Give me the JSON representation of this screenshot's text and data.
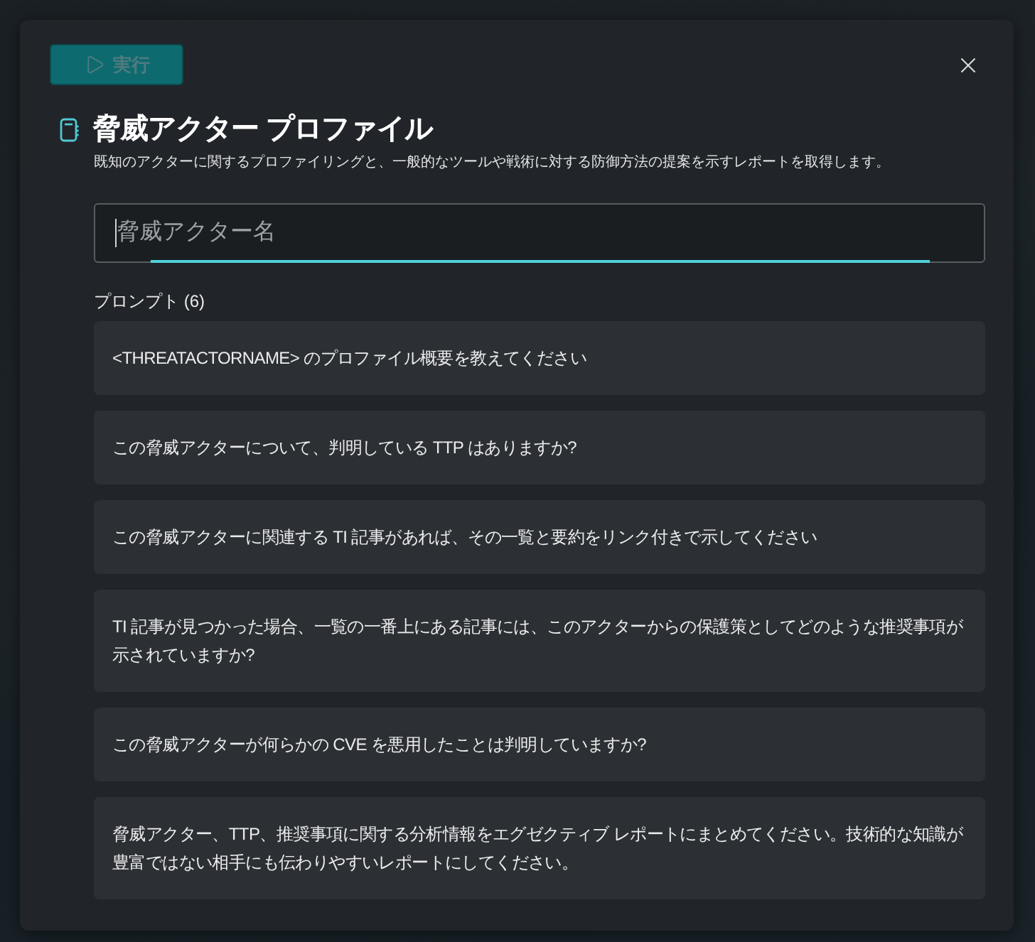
{
  "toolbar": {
    "run_button": {
      "label": "実行",
      "disabled": true
    }
  },
  "header": {
    "title": "脅威アクター プロファイル",
    "description": "既知のアクターに関するプロファイリングと、一般的なツールや戦術に対する防御方法の提案を示すレポートを取得します。"
  },
  "name_field": {
    "placeholder": "脅威アクター名",
    "focused": true
  },
  "prompts": {
    "label": "プロンプト (6)",
    "items": [
      "<THREATACTORNAME> のプロファイル概要を教えてください",
      "この脅威アクターについて、判明している TTP はありますか?",
      "この脅威アクターに関連する TI 記事があれば、その一覧と要約をリンク付きで示してください",
      "TI 記事が見つかった場合、一覧の一番上にある記事には、このアクターからの保護策としてどのような推奨事項が示されていますか?",
      "この脅威アクターが何らかの CVE を悪用したことは判明していますか?",
      "脅威アクター、TTP、推奨事項に関する分析情報をエグゼクティブ レポートにまとめてください。技術的な知識が豊富ではない相手にも伝わりやすいレポートにしてください。"
    ]
  }
}
